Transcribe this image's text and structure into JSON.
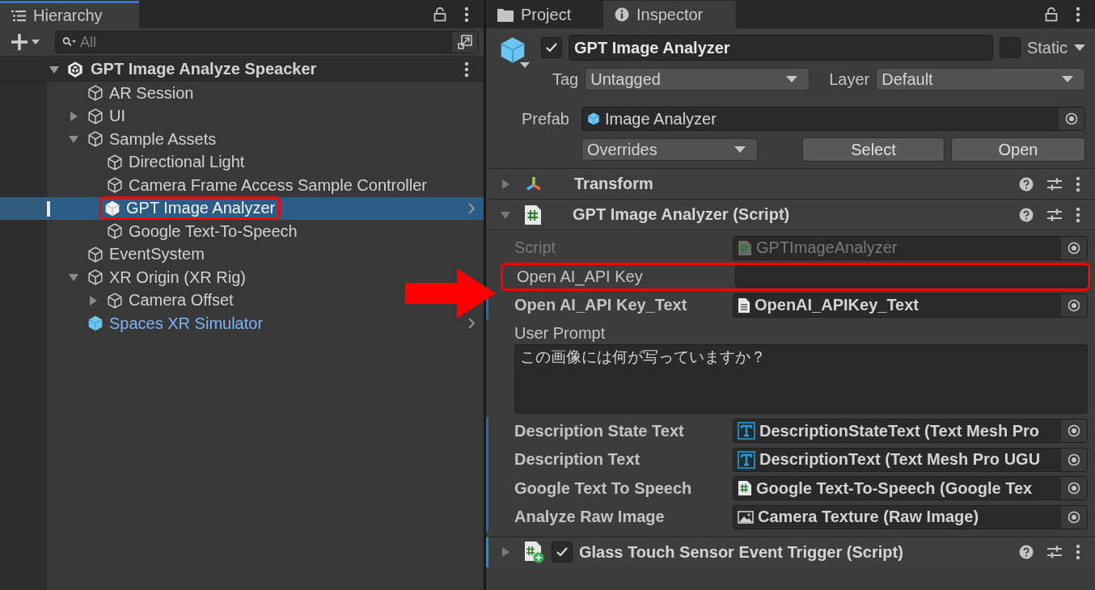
{
  "hierarchy": {
    "tab": "Hierarchy",
    "search": {
      "placeholder": "All"
    },
    "tree": [
      {
        "label": "GPT Image Analyze Speacker",
        "kind": "scene",
        "expanded": true,
        "selected": false,
        "children": [
          {
            "label": "AR Session",
            "kind": "object",
            "selected": false
          },
          {
            "label": "UI",
            "kind": "object",
            "expanded": false,
            "selected": false
          },
          {
            "label": "Sample Assets",
            "kind": "object",
            "expanded": true,
            "selected": false,
            "children": [
              {
                "label": "Directional Light",
                "kind": "object",
                "selected": false
              },
              {
                "label": "Camera Frame Access Sample Controller",
                "kind": "object",
                "selected": false
              },
              {
                "label": "GPT Image Analyzer",
                "kind": "prefab",
                "selected": true,
                "annotated": true
              },
              {
                "label": "Google Text-To-Speech",
                "kind": "object",
                "selected": false
              }
            ]
          },
          {
            "label": "EventSystem",
            "kind": "object",
            "selected": false
          },
          {
            "label": "XR Origin (XR Rig)",
            "kind": "object",
            "expanded": true,
            "selected": false,
            "children": [
              {
                "label": "Camera Offset",
                "kind": "object",
                "expanded": false,
                "selected": false
              }
            ]
          },
          {
            "label": "Spaces XR Simulator",
            "kind": "prefab",
            "selected": false
          }
        ]
      }
    ]
  },
  "inspector": {
    "tabs": [
      {
        "label": "Project",
        "kind": "project",
        "selected": false
      },
      {
        "label": "Inspector",
        "kind": "inspector",
        "selected": true
      }
    ],
    "object": {
      "active": true,
      "name": "GPT Image Analyzer",
      "static": false,
      "static_label": "Static",
      "tag_label": "Tag",
      "tag": "Untagged",
      "layer_label": "Layer",
      "layer": "Default",
      "prefab_label": "Prefab",
      "prefab": "Image Analyzer",
      "overrides": "Overrides",
      "select": "Select",
      "open": "Open"
    },
    "components": [
      {
        "title": "Transform",
        "kind": "transform",
        "expanded": false,
        "overridden": false
      },
      {
        "title": "GPT Image Analyzer (Script)",
        "kind": "script",
        "expanded": true,
        "overridden": false,
        "properties": [
          {
            "label": "Script",
            "kind": "script_ref",
            "value": "GPTImageAnalyzer",
            "disabled": true,
            "overridden": false
          },
          {
            "label": "Open AI_API Key",
            "kind": "text",
            "disabled": false,
            "overridden": false,
            "annotated": true
          },
          {
            "label": "Open AI_API Key_Text",
            "kind": "text_asset_ref",
            "value": "OpenAI_APIKey_Text",
            "disabled": false,
            "overridden": true
          },
          {
            "label": "User Prompt",
            "kind": "textarea",
            "value": "この画像には何が写っていますか？",
            "disabled": false,
            "overridden": false
          },
          {
            "label": "Description State Text",
            "kind": "text_mesh_ref",
            "value": "DescriptionStateText (Text Mesh Pro",
            "disabled": false,
            "overridden": true
          },
          {
            "label": "Description Text",
            "kind": "text_mesh_ref",
            "value": "DescriptionText (Text Mesh Pro UGU",
            "disabled": false,
            "overridden": true
          },
          {
            "label": "Google Text To Speech",
            "kind": "script_ref",
            "value": "Google Text-To-Speech (Google Tex",
            "disabled": false,
            "overridden": true
          },
          {
            "label": "Analyze Raw Image",
            "kind": "image_ref",
            "value": "Camera Texture (Raw Image)",
            "disabled": false,
            "overridden": true
          }
        ]
      },
      {
        "title": "Glass Touch Sensor Event Trigger (Script)",
        "kind": "script_added",
        "expanded": false,
        "overridden": true,
        "enabled": true
      }
    ]
  }
}
